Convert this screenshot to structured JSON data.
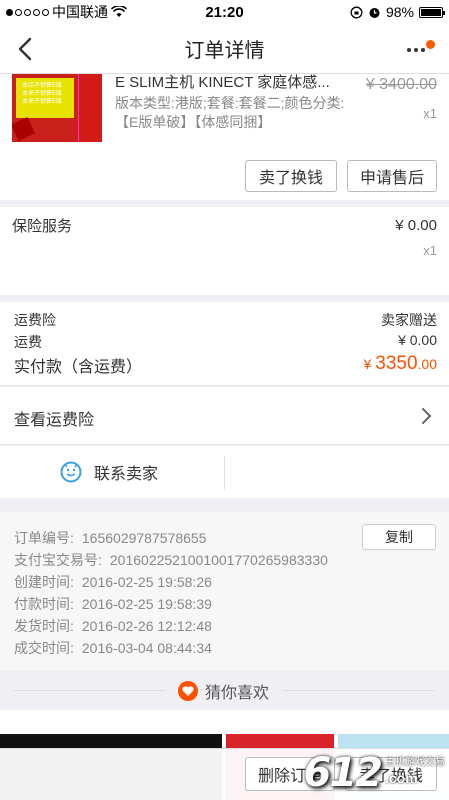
{
  "status_bar": {
    "carrier": "中国联通",
    "time": "21:20",
    "battery": "98%"
  },
  "nav": {
    "title": "订单详情",
    "back_icon": "chevron-left-icon",
    "more_icon": "more-icon",
    "badge_color": "#ff5a00"
  },
  "product": {
    "title": "E SLIM主机 KINECT 家庭体感...",
    "spec": "版本类型:港版;套餐:套餐二;颜色分类:【E版单破】【体感同捆】",
    "original_price": "¥ 3400.00",
    "quantity": "x1",
    "image_lines": [
      "本店不销售E版",
      "本来不销售E版",
      "本来不销售E版"
    ],
    "btn_exchange": "卖了换钱",
    "btn_aftersale": "申请售后"
  },
  "insurance": {
    "label": "保险服务",
    "price": "¥ 0.00",
    "quantity": "x1"
  },
  "summary": {
    "freight_insurance_label": "运费险",
    "freight_insurance_value": "卖家赠送",
    "shipping_label": "运费",
    "shipping_value": "¥ 0.00",
    "paid_label": "实付款（含运费）",
    "paid_currency": "¥ ",
    "paid_int": "3350",
    "paid_dec": ".00",
    "accent_color": "#ff5000"
  },
  "freight_link": {
    "label": "查看运费险"
  },
  "contact": {
    "label": "联系卖家",
    "icon": "wangwang-icon"
  },
  "order_info": {
    "copy_button": "复制",
    "rows": [
      {
        "label": "订单编号:",
        "value": "1656029787578655"
      },
      {
        "label": "支付宝交易号:",
        "value": "2016022521001001770265983330"
      },
      {
        "label": "创建时间:",
        "value": "2016-02-25 19:58:26"
      },
      {
        "label": "付款时间:",
        "value": "2016-02-25 19:58:39"
      },
      {
        "label": "发货时间:",
        "value": "2016-02-26 12:12:48"
      },
      {
        "label": "成交时间:",
        "value": "2016-03-04 08:44:34"
      }
    ]
  },
  "guess": {
    "label": "猜你喜欢",
    "icon": "heart-icon"
  },
  "bottom_bar": {
    "btn_delete": "删除订单",
    "btn_exchange": "卖了换钱"
  },
  "watermark": {
    "logo": "612",
    "sub": "主机游戏交易",
    "suffix": ".com"
  }
}
